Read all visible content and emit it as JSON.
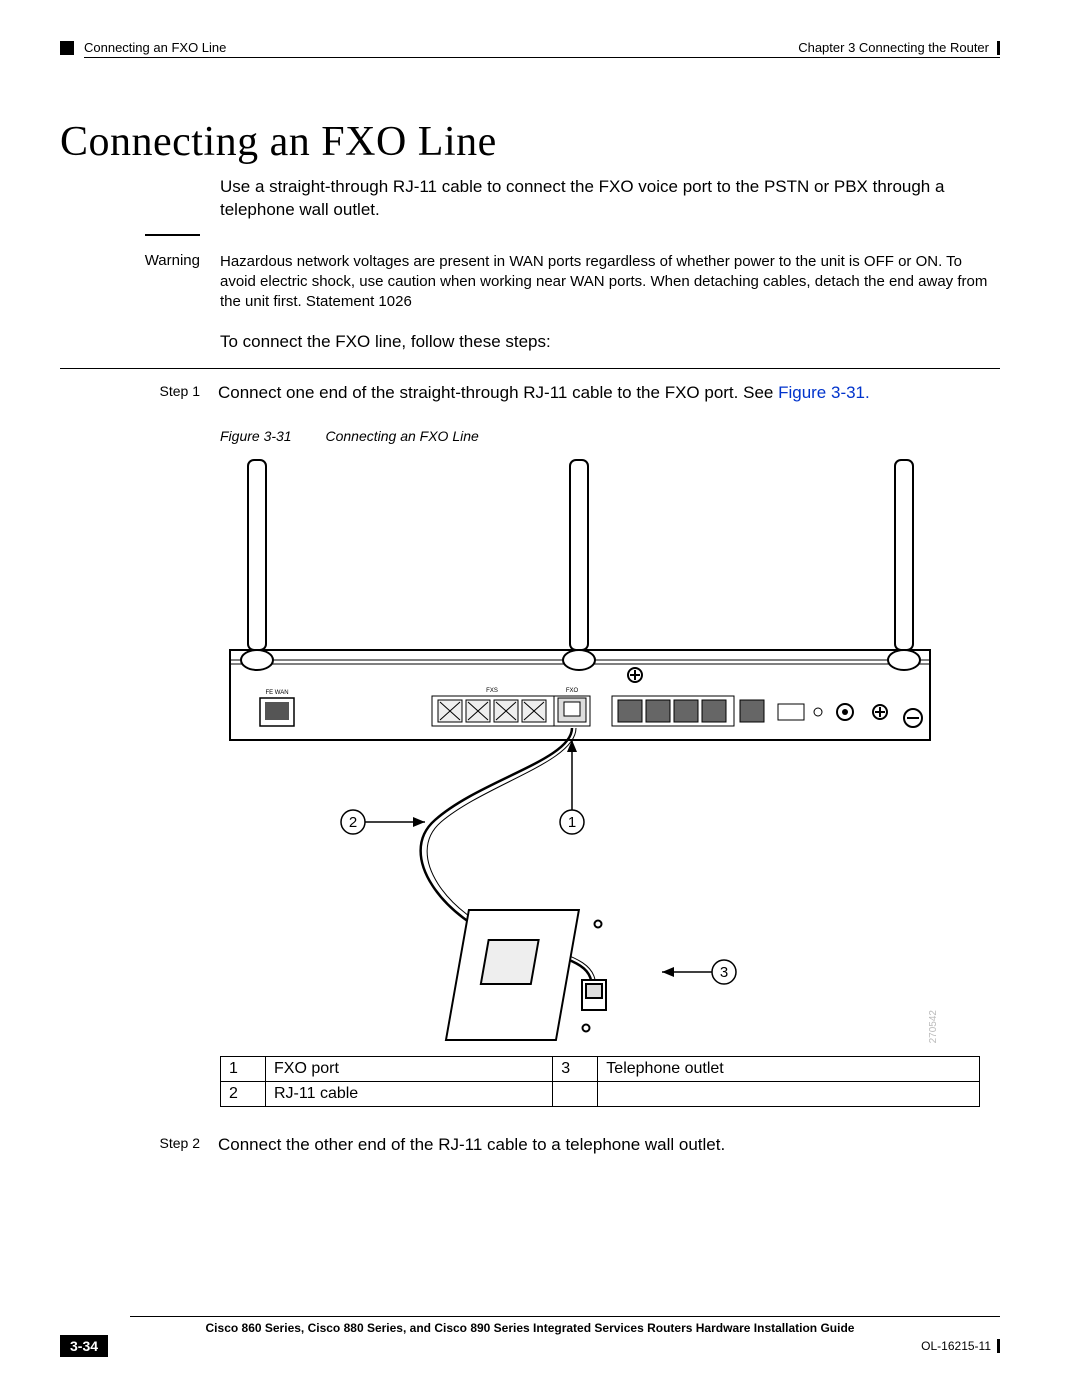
{
  "header": {
    "section": "Connecting an FXO Line",
    "chapter": "Chapter 3      Connecting the Router"
  },
  "title": "Connecting an FXO Line",
  "intro": "Use a straight-through RJ-11 cable to connect the FXO voice port to the PSTN or PBX through a telephone wall outlet.",
  "warning": {
    "label": "Warning",
    "text": "Hazardous network voltages are present in WAN ports regardless of whether power to the unit is OFF or ON. To avoid electric shock, use caution when working near WAN ports. When detaching cables, detach the end away from the unit first. ",
    "statement": "Statement 1026"
  },
  "lead": "To connect the FXO line, follow these steps:",
  "steps": {
    "s1": {
      "label": "Step 1",
      "text": "Connect one end of the straight-through RJ-11 cable to the FXO port. See ",
      "xref": "Figure 3-31."
    },
    "s2": {
      "label": "Step 2",
      "text": "Connect the other end of the RJ-11 cable to a telephone wall outlet."
    }
  },
  "figure": {
    "label": "Figure 3-31",
    "caption": "Connecting an FXO Line",
    "labels": {
      "fewan": "FE WAN",
      "fxs": "FXS",
      "fxo": "FXO"
    },
    "callouts": {
      "c1": "1",
      "c2": "2",
      "c3": "3"
    },
    "srcnum": "270542"
  },
  "legend": {
    "r1": {
      "n": "1",
      "t": "FXO port"
    },
    "r2": {
      "n": "2",
      "t": "RJ-11 cable"
    },
    "r3": {
      "n": "3",
      "t": "Telephone outlet"
    }
  },
  "footer": {
    "guide": "Cisco 860 Series, Cisco 880 Series, and Cisco 890 Series Integrated Services Routers Hardware Installation Guide",
    "page": "3-34",
    "doc": "OL-16215-11"
  }
}
